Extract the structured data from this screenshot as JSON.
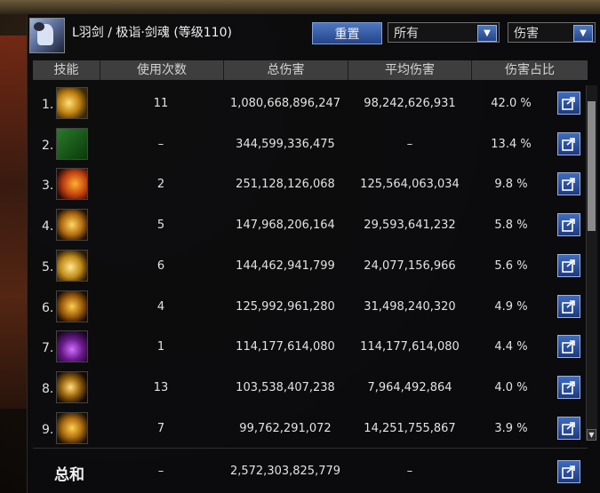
{
  "header": {
    "title": "L羽剑 / 极诣·剑魂 (等级110)",
    "reset_label": "重置",
    "filter_select": "所有",
    "type_select": "伤害"
  },
  "columns": [
    "技能",
    "使用次数",
    "总伤害",
    "平均伤害",
    "伤害占比"
  ],
  "rows": [
    {
      "index": "1.",
      "uses": "11",
      "total": "1,080,668,896,247",
      "avg": "98,242,626,931",
      "pct": "42.0 %",
      "icon": "skill-crescent-slash-icon"
    },
    {
      "index": "2.",
      "uses": "–",
      "total": "344,599,336,475",
      "avg": "–",
      "pct": "13.4 %",
      "icon": "skill-green-rune-icon"
    },
    {
      "index": "3.",
      "uses": "2",
      "total": "251,128,126,068",
      "avg": "125,564,063,034",
      "pct": "9.8 %",
      "icon": "skill-fire-burst-icon"
    },
    {
      "index": "4.",
      "uses": "5",
      "total": "147,968,206,164",
      "avg": "29,593,641,232",
      "pct": "5.8 %",
      "icon": "skill-golden-spikes-icon"
    },
    {
      "index": "5.",
      "uses": "6",
      "total": "144,462,941,799",
      "avg": "24,077,156,966",
      "pct": "5.6 %",
      "icon": "skill-wind-slash-icon"
    },
    {
      "index": "6.",
      "uses": "4",
      "total": "125,992,961,280",
      "avg": "31,498,240,320",
      "pct": "4.9 %",
      "icon": "skill-blade-flurry-icon"
    },
    {
      "index": "7.",
      "uses": "1",
      "total": "114,177,614,080",
      "avg": "114,177,614,080",
      "pct": "4.4 %",
      "icon": "skill-violet-explosion-icon"
    },
    {
      "index": "8.",
      "uses": "13",
      "total": "103,538,407,238",
      "avg": "7,964,492,864",
      "pct": "4.0 %",
      "icon": "skill-arc-swing-icon"
    },
    {
      "index": "9.",
      "uses": "7",
      "total": "99,762,291,072",
      "avg": "14,251,755,867",
      "pct": "3.9 %",
      "icon": "skill-triple-slash-icon"
    }
  ],
  "total": {
    "label": "总和",
    "uses": "–",
    "total": "2,572,303,825,779",
    "avg": "–"
  },
  "colors": {
    "accent": "#2f58a8",
    "header_bg": "#3e3e3e",
    "panel_bg": "#0c0c0e"
  }
}
